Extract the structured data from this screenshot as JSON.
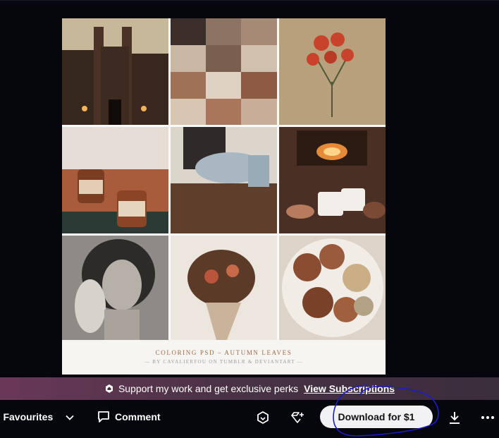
{
  "artwork": {
    "caption_title": "COLORING PSD  –  AUTUMN LEAVES",
    "caption_credit": "— BY CAVALIERFOU ON TUMBLR & DEVIANTART —",
    "palette": {
      "accent": "#9b6a48",
      "background": "#fbfaf8"
    }
  },
  "perks_banner": {
    "text": "Support my work and get exclusive perks",
    "link_label": "View Subscriptions"
  },
  "toolbar": {
    "favourites_label": "o Favourites",
    "comment_label": "Comment",
    "download_label": "Download for $1",
    "icons": [
      "chevron-down-icon",
      "comment-icon",
      "gift-icon",
      "add-collection-icon",
      "download-icon",
      "more-icon"
    ]
  },
  "colors": {
    "page_bg": "#06070d",
    "annotation": "#1c1ccc",
    "button_bg": "#f2f2f4"
  }
}
